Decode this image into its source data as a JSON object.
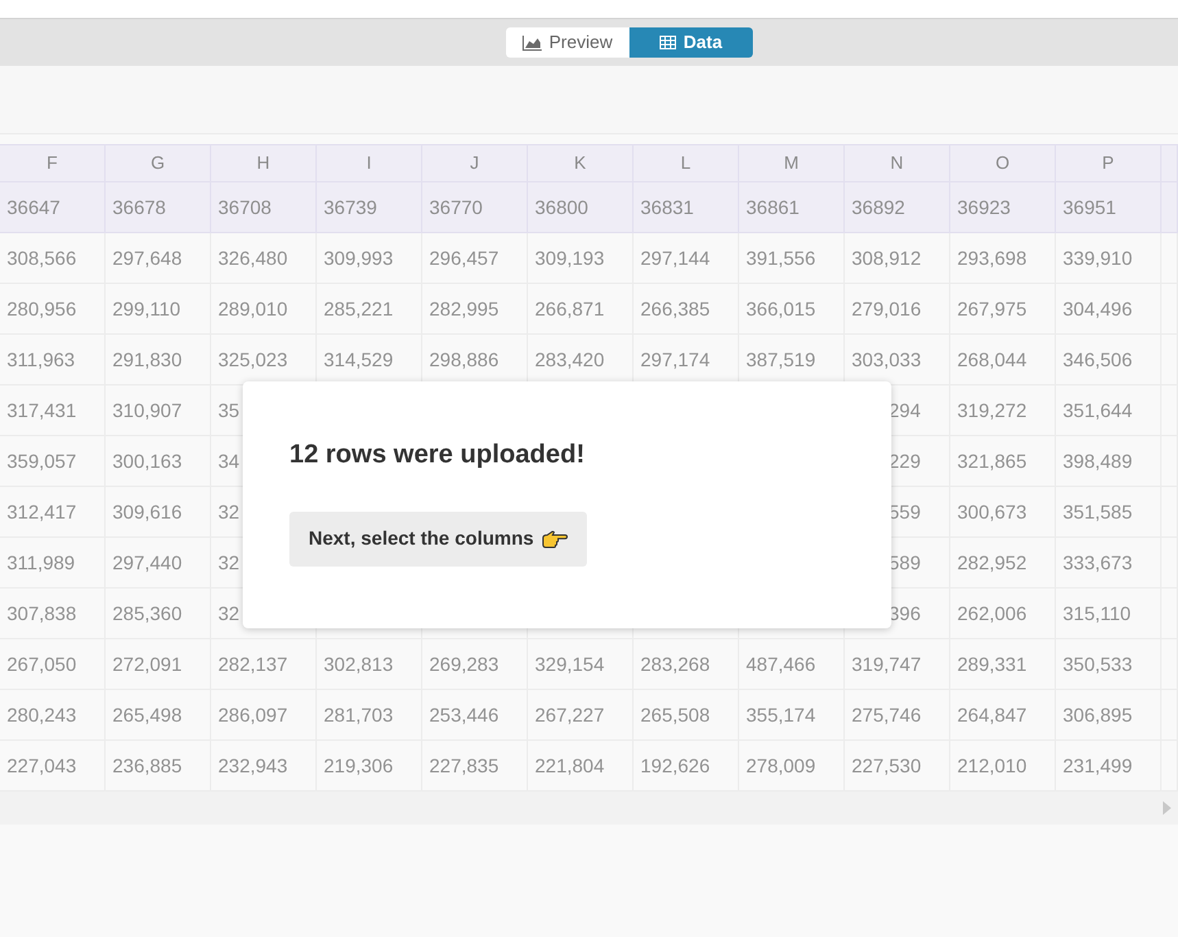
{
  "view_toggle": [
    {
      "label": "Preview",
      "kind": "chart",
      "selected": false
    },
    {
      "label": "Data",
      "kind": "table",
      "selected": true
    }
  ],
  "table": {
    "columns": [
      "F",
      "G",
      "H",
      "I",
      "J",
      "K",
      "L",
      "M",
      "N",
      "O",
      "P"
    ],
    "rows": [
      {
        "header": true,
        "cells": [
          "36647",
          "36678",
          "36708",
          "36739",
          "36770",
          "36800",
          "36831",
          "36861",
          "36892",
          "36923",
          "36951"
        ]
      },
      {
        "header": false,
        "cells": [
          "308,566",
          "297,648",
          "326,480",
          "309,993",
          "296,457",
          "309,193",
          "297,144",
          "391,556",
          "308,912",
          "293,698",
          "339,910"
        ]
      },
      {
        "header": false,
        "cells": [
          "280,956",
          "299,110",
          "289,010",
          "285,221",
          "282,995",
          "266,871",
          "266,385",
          "366,015",
          "279,016",
          "267,975",
          "304,496"
        ]
      },
      {
        "header": false,
        "cells": [
          "311,963",
          "291,830",
          "325,023",
          "314,529",
          "298,886",
          "283,420",
          "297,174",
          "387,519",
          "303,033",
          "268,044",
          "346,506"
        ]
      },
      {
        "header": false,
        "cells": [
          "317,431",
          "310,907",
          "35",
          null,
          null,
          null,
          null,
          null,
          "294",
          "319,272",
          "351,644"
        ]
      },
      {
        "header": false,
        "cells": [
          "359,057",
          "300,163",
          "34",
          null,
          null,
          null,
          null,
          null,
          "229",
          "321,865",
          "398,489"
        ]
      },
      {
        "header": false,
        "cells": [
          "312,417",
          "309,616",
          "32",
          null,
          null,
          null,
          null,
          null,
          "559",
          "300,673",
          "351,585"
        ]
      },
      {
        "header": false,
        "cells": [
          "311,989",
          "297,440",
          "32",
          null,
          null,
          null,
          null,
          null,
          "589",
          "282,952",
          "333,673"
        ]
      },
      {
        "header": false,
        "cells": [
          "307,838",
          "285,360",
          "32",
          null,
          null,
          null,
          null,
          null,
          "396",
          "262,006",
          "315,110"
        ]
      },
      {
        "header": false,
        "cells": [
          "267,050",
          "272,091",
          "282,137",
          "302,813",
          "269,283",
          "329,154",
          "283,268",
          "487,466",
          "319,747",
          "289,331",
          "350,533"
        ]
      },
      {
        "header": false,
        "cells": [
          "280,243",
          "265,498",
          "286,097",
          "281,703",
          "253,446",
          "267,227",
          "265,508",
          "355,174",
          "275,746",
          "264,847",
          "306,895"
        ]
      },
      {
        "header": false,
        "cells": [
          "227,043",
          "236,885",
          "232,943",
          "219,306",
          "227,835",
          "221,804",
          "192,626",
          "278,009",
          "227,530",
          "212,010",
          "231,499"
        ]
      }
    ]
  },
  "dialog": {
    "title": "12 rows were uploaded!",
    "button": "Next, select the columns"
  }
}
